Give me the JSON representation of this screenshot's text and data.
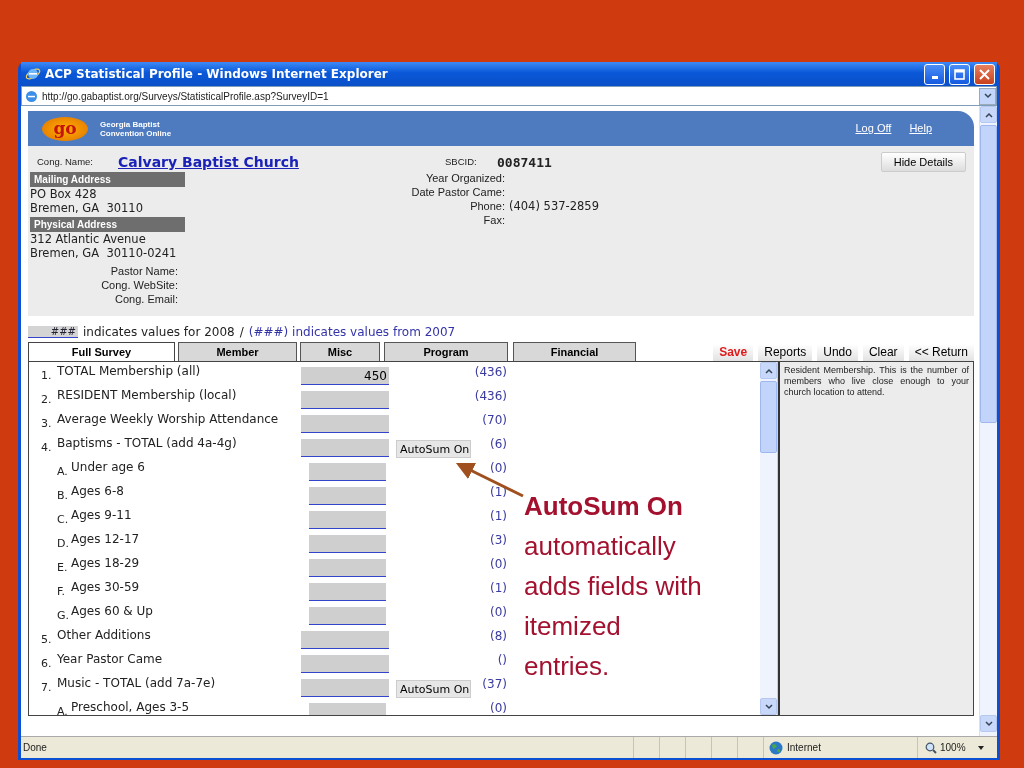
{
  "window": {
    "title": "ACP Statistical Profile - Windows Internet Explorer"
  },
  "address_bar": {
    "url": "http://go.gabaptist.org/Surveys/StatisticalProfile.asp?SurveyID=1"
  },
  "header": {
    "logo_text": "go",
    "site_name": [
      "Georgia Baptist",
      "Convention Online"
    ],
    "links": [
      "Log Off",
      "Help"
    ]
  },
  "congregation": {
    "name_label": "Cong. Name:",
    "name": "Calvary Baptist Church",
    "sbcid_label": "SBCID:",
    "sbcid": "0087411",
    "hide_button": "Hide Details"
  },
  "addresses": [
    {
      "heading": "Mailing Address",
      "lines": [
        "PO Box 428",
        "Bremen, GA  30110"
      ]
    },
    {
      "heading": "Physical Address",
      "lines": [
        "312 Atlantic Avenue",
        "Bremen, GA  30110-0241"
      ]
    }
  ],
  "contact_fields": [
    "Pastor Name:",
    "Cong. WebSite:",
    "Cong. Email:"
  ],
  "details": [
    {
      "label": "Year Organized:"
    },
    {
      "label": "Date Pastor Came:"
    },
    {
      "label": "Phone:",
      "value": "(404) 537-2859"
    },
    {
      "label": "Fax:"
    }
  ],
  "legend": {
    "sample": "###",
    "current_text": "indicates values for 2008",
    "separator": "/",
    "previous_text": "(###) indicates values from 2007"
  },
  "tabs": [
    {
      "label": "Full Survey",
      "selected": true
    },
    {
      "label": "Member",
      "selected": false
    },
    {
      "label": "Misc",
      "selected": false
    },
    {
      "label": "Program",
      "selected": false
    },
    {
      "label": "Financial",
      "selected": false
    }
  ],
  "actions": [
    {
      "label": "Save",
      "kind": "save"
    },
    {
      "label": "Reports",
      "kind": "plain"
    },
    {
      "label": "Undo",
      "kind": "plain"
    },
    {
      "label": "Clear",
      "kind": "plain"
    },
    {
      "label": "<< Return",
      "kind": "plain"
    }
  ],
  "questions": [
    {
      "number": "1.",
      "label": "TOTAL Membership (all)",
      "value": "450",
      "previous": "(436)"
    },
    {
      "number": "2.",
      "label": "RESIDENT Membership (local)",
      "previous": "(436)"
    },
    {
      "number": "3.",
      "label": "Average Weekly Worship Attendance",
      "previous": "(70)"
    },
    {
      "number": "4.",
      "label": "Baptisms - TOTAL (add 4a-4g)",
      "autosum_button": "AutoSum On",
      "previous": "(6)",
      "children": [
        {
          "number": "A.",
          "label": "Under age 6",
          "previous": "(0)"
        },
        {
          "number": "B.",
          "label": "Ages 6-8",
          "previous": "(1)"
        },
        {
          "number": "C.",
          "label": "Ages 9-11",
          "previous": "(1)"
        },
        {
          "number": "D.",
          "label": "Ages 12-17",
          "previous": "(3)"
        },
        {
          "number": "E.",
          "label": "Ages 18-29",
          "previous": "(0)"
        },
        {
          "number": "F.",
          "label": "Ages 30-59",
          "previous": "(1)"
        },
        {
          "number": "G.",
          "label": "Ages 60 & Up",
          "previous": "(0)"
        }
      ]
    },
    {
      "number": "5.",
      "label": "Other Additions",
      "previous": "(8)"
    },
    {
      "number": "6.",
      "label": "Year Pastor Came",
      "previous": "()"
    },
    {
      "number": "7.",
      "label": "Music - TOTAL (add 7a-7e)",
      "autosum_button": "AutoSum On",
      "previous": "(37)",
      "children": [
        {
          "number": "A.",
          "label": "Preschool, Ages 3-5",
          "previous": "(0)"
        }
      ]
    }
  ],
  "help_text": "Resident Membership. This is the number of members who live close enough to your church location to attend.",
  "annotation": {
    "text": "**AutoSum On** automatically adds fields with itemized entries."
  },
  "status_bar": {
    "status": "Done",
    "zone": "Internet",
    "zoom": "100%"
  }
}
